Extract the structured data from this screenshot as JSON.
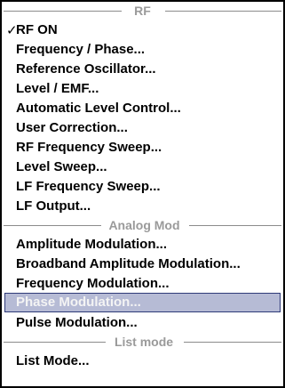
{
  "menu": {
    "sections": {
      "rf": "RF",
      "analog_mod": "Analog Mod",
      "list_mode": "List mode"
    },
    "items": {
      "rf_on": "RF ON",
      "frequency_phase": "Frequency / Phase...",
      "reference_oscillator": "Reference Oscillator...",
      "level_emf": "Level / EMF...",
      "automatic_level_control": "Automatic Level Control...",
      "user_correction": "User Correction...",
      "rf_frequency_sweep": "RF Frequency Sweep...",
      "level_sweep": "Level Sweep...",
      "lf_frequency_sweep": "LF Frequency Sweep...",
      "lf_output": "LF Output...",
      "amplitude_modulation": "Amplitude Modulation...",
      "broadband_amplitude_modulation": "Broadband Amplitude Modulation...",
      "frequency_modulation": "Frequency Modulation...",
      "phase_modulation": "Phase Modulation...",
      "pulse_modulation": "Pulse Modulation...",
      "list_mode": "List Mode..."
    },
    "checkmark": "✓",
    "checked_item": "RF ON",
    "selected_item": "Phase Modulation..."
  }
}
